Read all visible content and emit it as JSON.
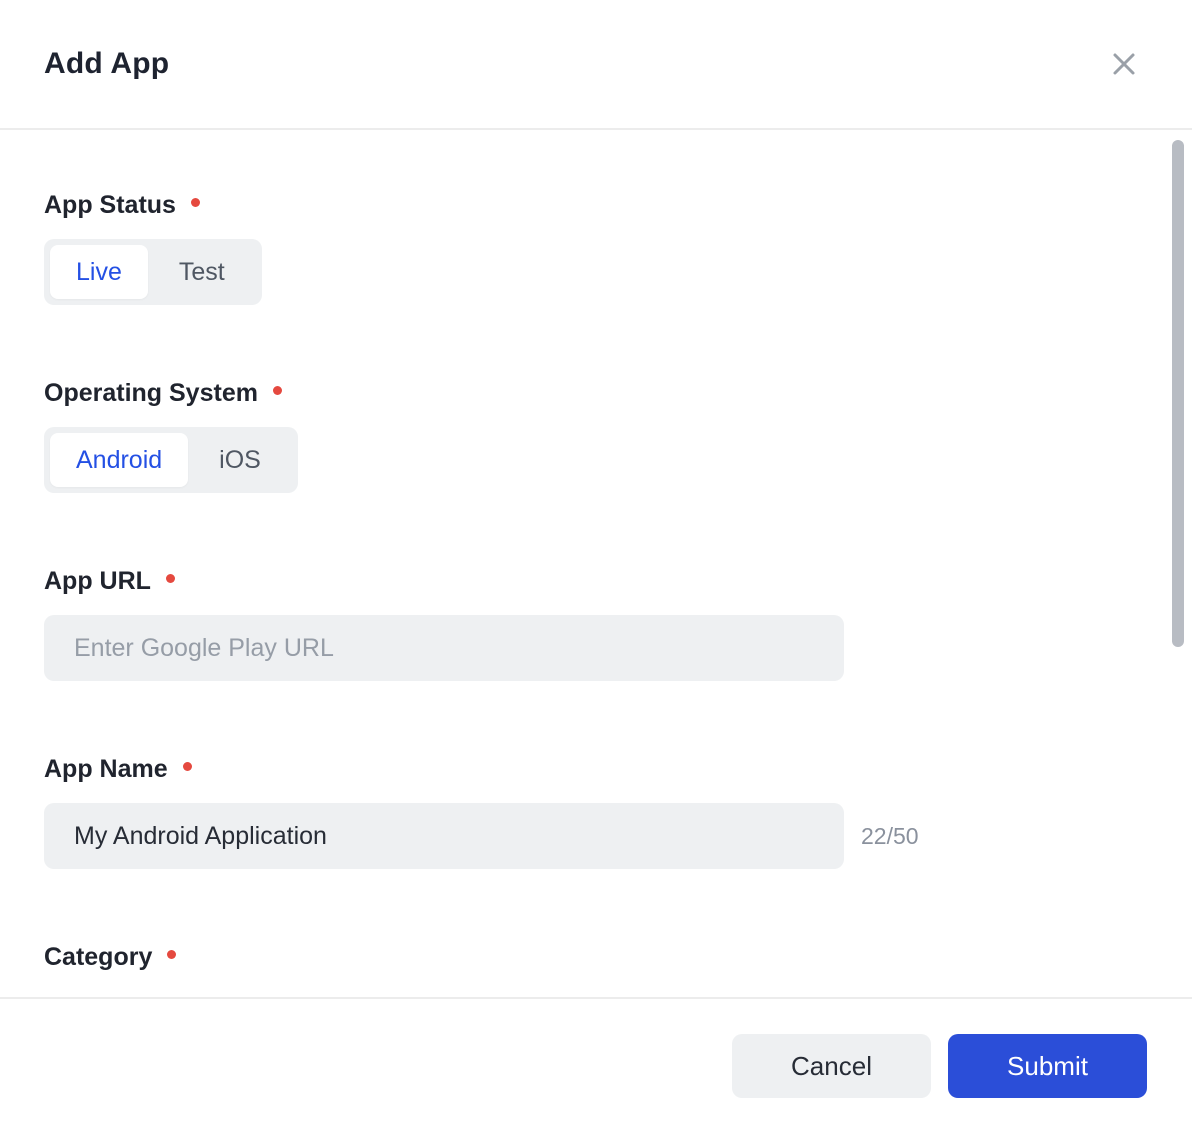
{
  "modal": {
    "title": "Add App"
  },
  "fields": {
    "app_status": {
      "label": "App Status",
      "required": true,
      "options": [
        {
          "label": "Live",
          "selected": true
        },
        {
          "label": "Test",
          "selected": false
        }
      ]
    },
    "operating_system": {
      "label": "Operating System",
      "required": true,
      "options": [
        {
          "label": "Android",
          "selected": true
        },
        {
          "label": "iOS",
          "selected": false
        }
      ]
    },
    "app_url": {
      "label": "App URL",
      "required": true,
      "value": "",
      "placeholder": "Enter Google Play URL"
    },
    "app_name": {
      "label": "App Name",
      "required": true,
      "value": "My Android Application",
      "counter": "22/50"
    },
    "category": {
      "label": "Category",
      "required": true
    }
  },
  "footer": {
    "cancel_label": "Cancel",
    "submit_label": "Submit"
  },
  "colors": {
    "accent_blue": "#2b4ed8",
    "selected_segment_text": "#2450e4",
    "required_dot_red": "#e5493f",
    "control_gray": "#eef0f2"
  }
}
